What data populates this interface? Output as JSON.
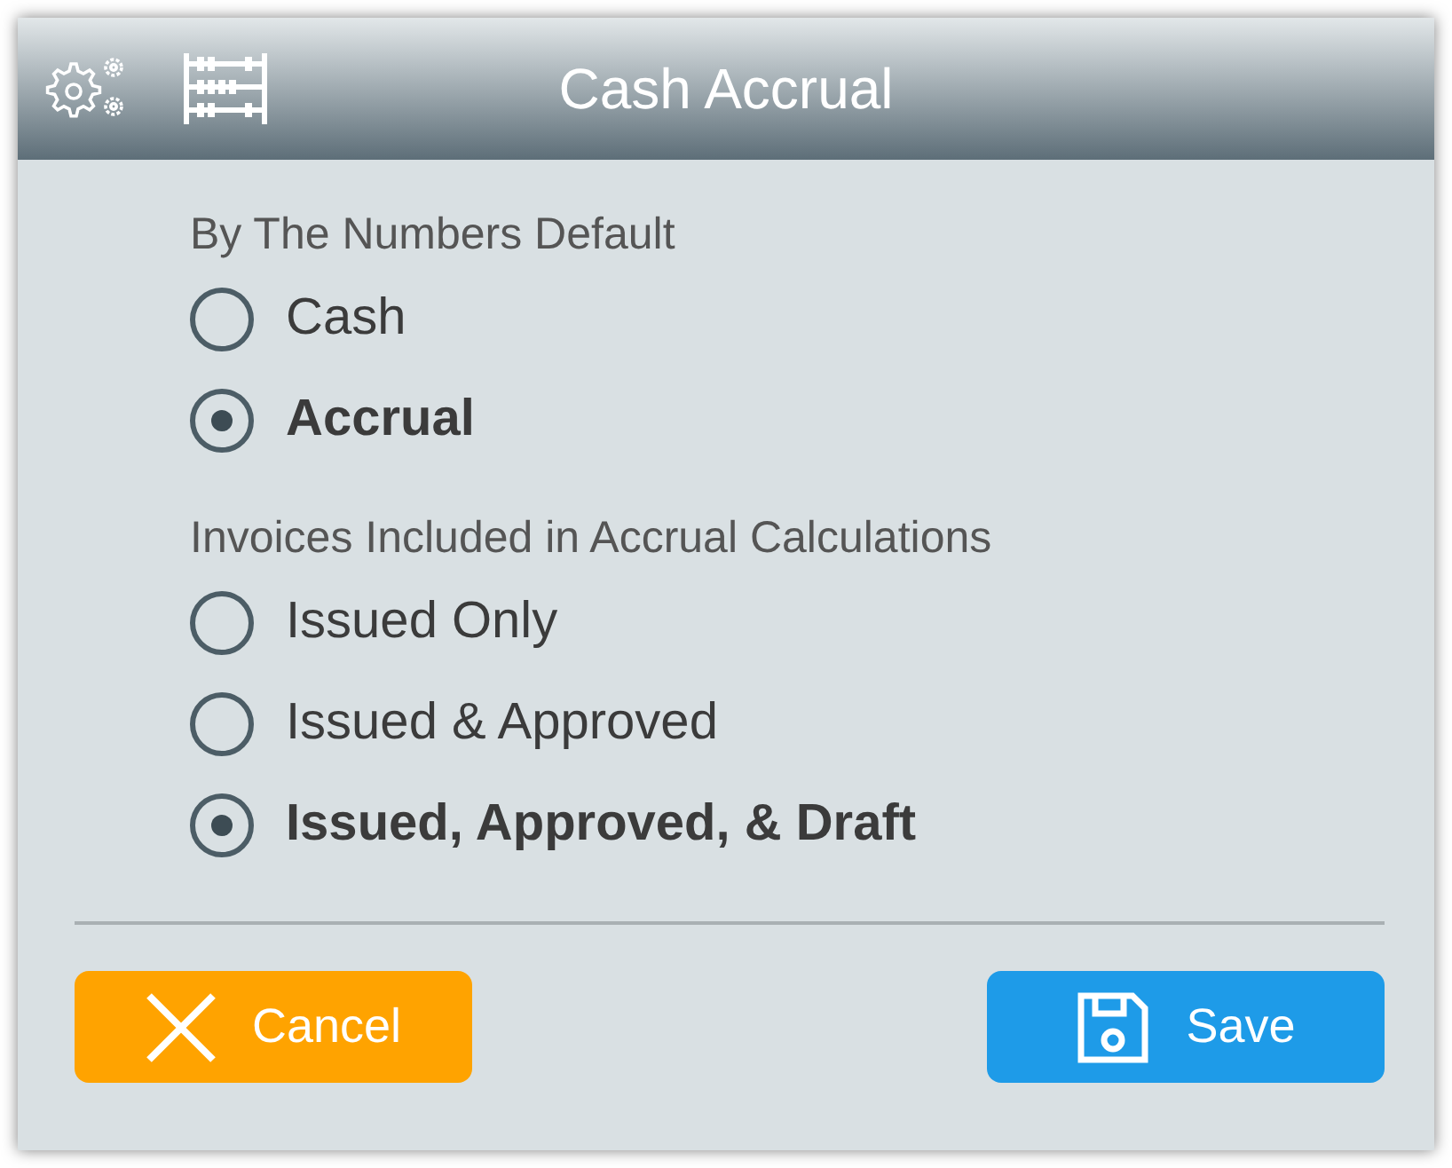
{
  "window": {
    "title": "Cash Accrual"
  },
  "groups": [
    {
      "label": "By The Numbers Default",
      "options": [
        {
          "label": "Cash",
          "selected": false
        },
        {
          "label": "Accrual",
          "selected": true
        }
      ]
    },
    {
      "label": "Invoices Included in Accrual Calculations",
      "options": [
        {
          "label": "Issued Only",
          "selected": false
        },
        {
          "label": "Issued & Approved",
          "selected": false
        },
        {
          "label": "Issued, Approved, & Draft",
          "selected": true
        }
      ]
    }
  ],
  "buttons": [
    {
      "kind": "cancel",
      "label": "Cancel"
    },
    {
      "kind": "save",
      "label": "Save"
    }
  ]
}
